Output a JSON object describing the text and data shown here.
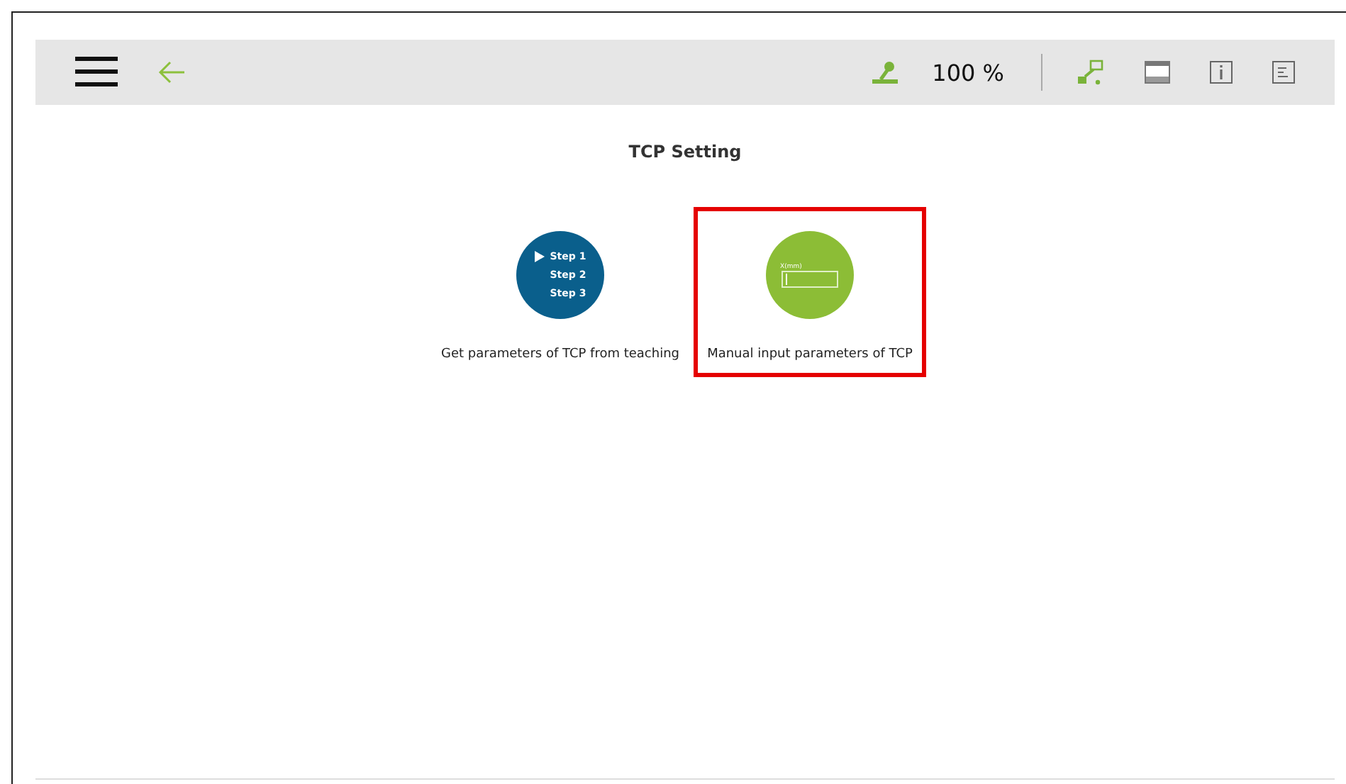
{
  "toolbar": {
    "speed": "100 %"
  },
  "title": "TCP Setting",
  "options": [
    {
      "kind": "steps",
      "label": "Get parameters of TCP from teaching",
      "selected": false,
      "steps": [
        "Step 1",
        "Step 2",
        "Step 3"
      ]
    },
    {
      "kind": "input",
      "label": "Manual input parameters of TCP",
      "selected": true,
      "field_label": "X(mm)"
    }
  ]
}
